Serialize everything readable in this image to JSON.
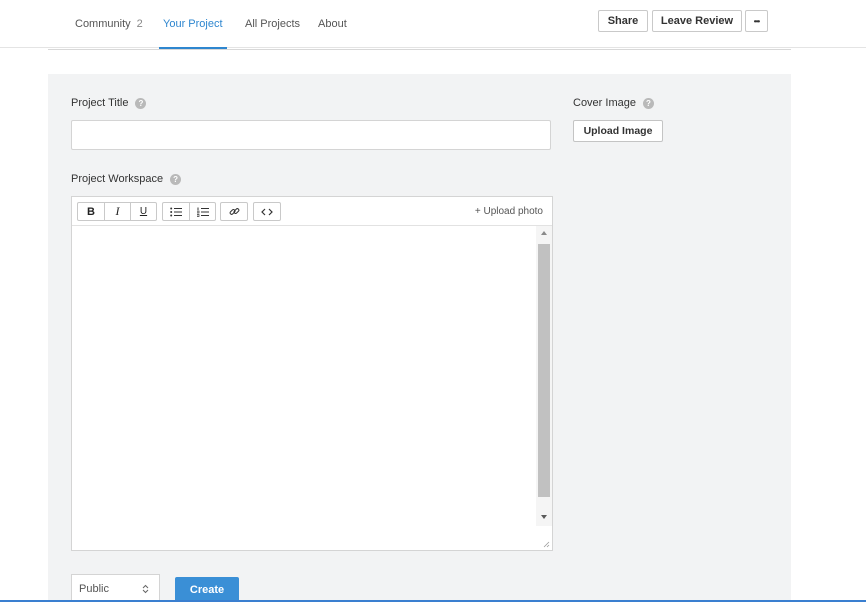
{
  "nav": {
    "tabs": [
      {
        "label": "Community",
        "count": "2"
      },
      {
        "label": "Your Project"
      },
      {
        "label": "All Projects"
      },
      {
        "label": "About"
      }
    ],
    "active_tab": "Your Project",
    "share_label": "Share",
    "leave_review_label": "Leave Review",
    "more_label": "•••"
  },
  "form": {
    "project_title_label": "Project Title",
    "project_title_value": "",
    "cover_image_label": "Cover Image",
    "upload_image_label": "Upload Image",
    "workspace_label": "Project Workspace",
    "help_glyph": "?",
    "editor": {
      "bold": "B",
      "italic": "I",
      "underline": "U",
      "link_icon": "link-icon",
      "code_icon": "code-icon",
      "upload_photo_label": "+ Upload photo",
      "content": ""
    },
    "visibility_value": "Public",
    "create_label": "Create"
  },
  "colors": {
    "accent": "#2e86cf",
    "primary_button": "#3a8fd6",
    "panel_bg": "#f2f3f4"
  }
}
